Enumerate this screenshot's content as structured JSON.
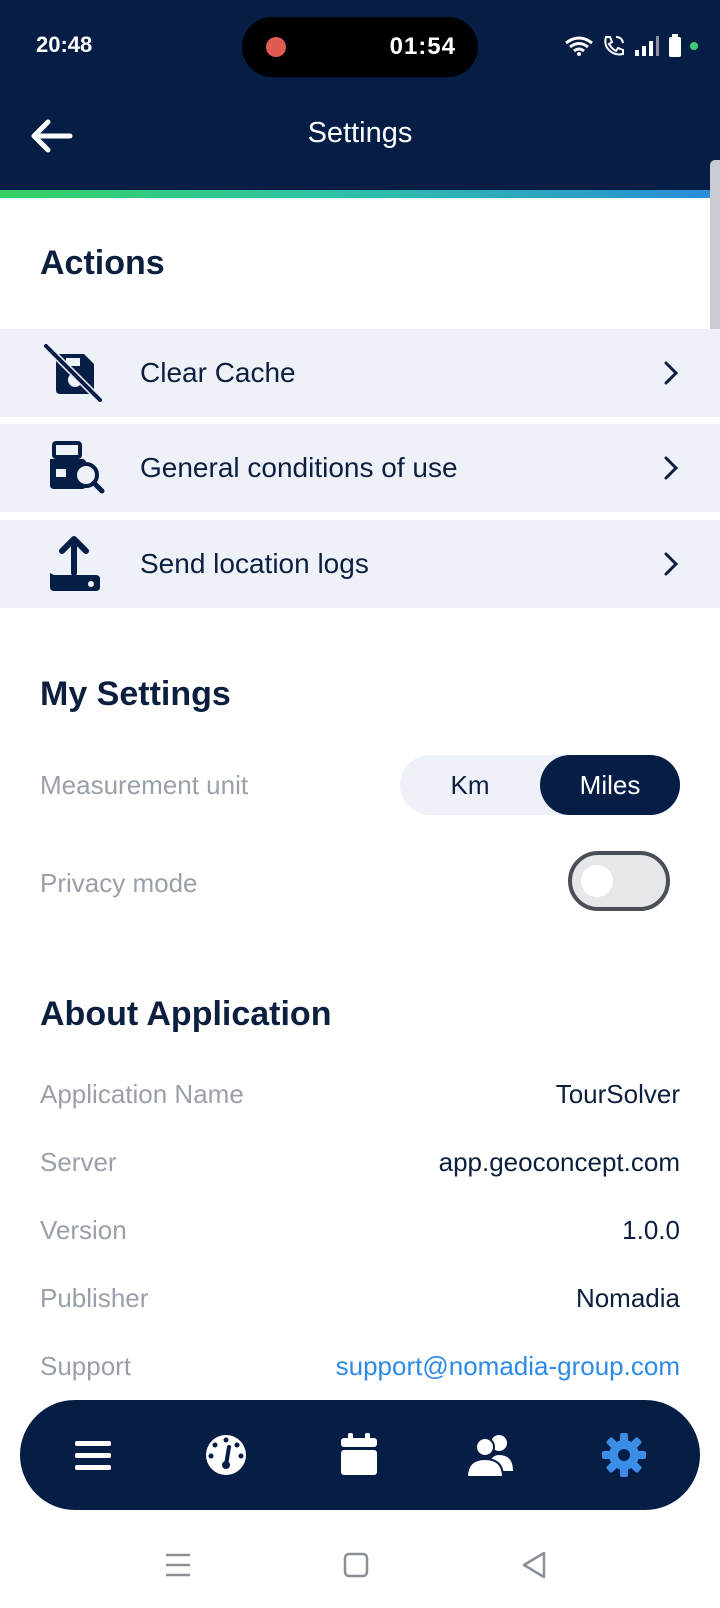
{
  "status_bar": {
    "time": "20:48",
    "recording_timer": "01:54",
    "icons": [
      "wifi-icon",
      "wifi-call-icon",
      "signal-icon",
      "battery-icon"
    ]
  },
  "header": {
    "back_icon": "arrow-left-icon",
    "title": "Settings"
  },
  "actions": {
    "title": "Actions",
    "items": [
      {
        "label": "Clear Cache",
        "icon": "clear-cache-icon"
      },
      {
        "label": "General conditions of use",
        "icon": "conditions-icon"
      },
      {
        "label": "Send location logs",
        "icon": "upload-icon"
      }
    ]
  },
  "my_settings": {
    "title": "My Settings",
    "measurement_unit": {
      "label": "Measurement unit",
      "options": [
        "Km",
        "Miles"
      ],
      "selected": "Miles"
    },
    "privacy_mode": {
      "label": "Privacy mode",
      "enabled": false
    }
  },
  "about": {
    "title": "About Application",
    "rows": [
      {
        "label": "Application Name",
        "value": "TourSolver"
      },
      {
        "label": "Server",
        "value": "app.geoconcept.com"
      },
      {
        "label": "Version",
        "value": "1.0.0"
      },
      {
        "label": "Publisher",
        "value": "Nomadia"
      },
      {
        "label": "Support",
        "value": "support@nomadia-group.com"
      }
    ]
  },
  "bottom_nav": {
    "items": [
      "menu-icon",
      "dashboard-icon",
      "calendar-icon",
      "users-icon",
      "settings-icon"
    ],
    "active": "settings-icon"
  },
  "colors": {
    "header_bg": "#061d45",
    "accent_blue": "#2e8ae6",
    "row_bg": "#eef1f8",
    "muted_text": "#9aa0aa",
    "gradient": [
      "#38d064",
      "#2a8cd8"
    ]
  }
}
